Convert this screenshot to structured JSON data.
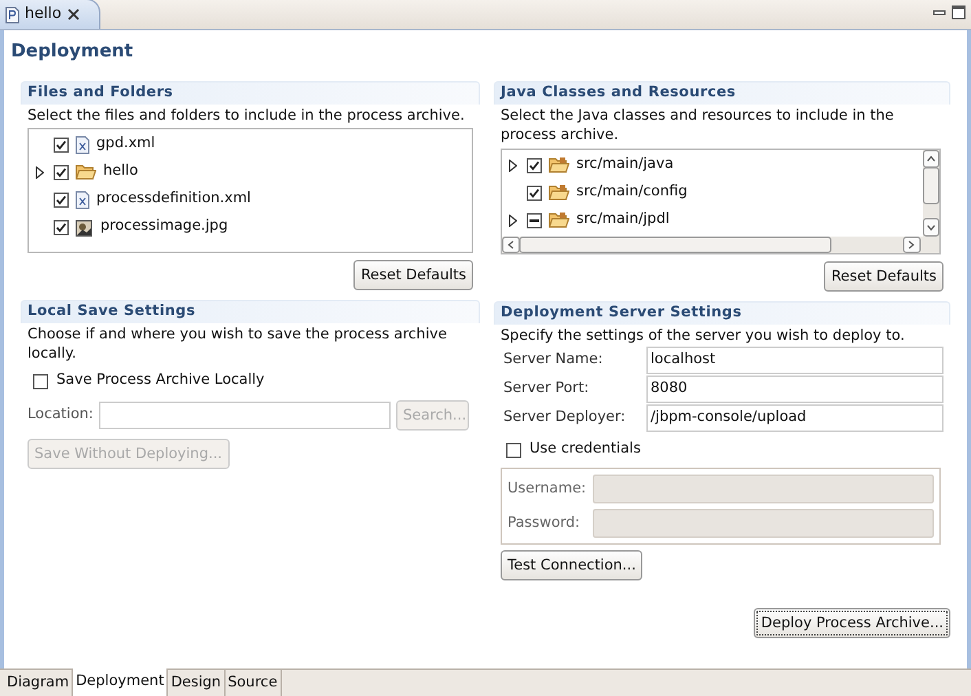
{
  "editor_tab": {
    "label": "hello",
    "selected": true
  },
  "page_title": "Deployment",
  "files": {
    "title": "Files and Folders",
    "description": "Select the files and folders to include in the process archive.",
    "items": [
      {
        "name": "gpd.xml",
        "kind": "xml",
        "checked": true,
        "partial": false,
        "expandable": false
      },
      {
        "name": "hello",
        "kind": "folder",
        "checked": true,
        "partial": false,
        "expandable": true
      },
      {
        "name": "processdefinition.xml",
        "kind": "xml",
        "checked": true,
        "partial": false,
        "expandable": false
      },
      {
        "name": "processimage.jpg",
        "kind": "image",
        "checked": true,
        "partial": false,
        "expandable": false
      }
    ],
    "reset_button": "Reset Defaults"
  },
  "classes": {
    "title": "Java Classes and Resources",
    "description": "Select the Java classes and resources to include in the process archive.",
    "items": [
      {
        "name": "src/main/java",
        "kind": "package",
        "checked": true,
        "partial": false,
        "expandable": true
      },
      {
        "name": "src/main/config",
        "kind": "package",
        "checked": true,
        "partial": false,
        "expandable": false
      },
      {
        "name": "src/main/jpdl",
        "kind": "package",
        "checked": true,
        "partial": true,
        "expandable": true
      }
    ],
    "reset_button": "Reset Defaults"
  },
  "local_save": {
    "title": "Local Save Settings",
    "description": "Choose if and where you wish to save the process archive locally.",
    "save_locally": {
      "label": "Save Process Archive Locally",
      "checked": false
    },
    "location_label": "Location:",
    "search_button": {
      "label": "Search...",
      "disabled": true
    },
    "save_button": {
      "label": "Save Without Deploying...",
      "disabled": true
    }
  },
  "server": {
    "title": "Deployment Server Settings",
    "description": "Specify the settings of the server you wish to deploy to.",
    "fields": [
      {
        "label": "Server Name:",
        "value": "localhost"
      },
      {
        "label": "Server Port:",
        "value": "8080"
      },
      {
        "label": "Server Deployer:",
        "value": "/jbpm-console/upload"
      }
    ],
    "use_credentials": {
      "label": "Use credentials",
      "checked": false
    },
    "credentials": [
      {
        "label": "Username:",
        "disabled": true
      },
      {
        "label": "Password:",
        "disabled": true
      }
    ],
    "test_button": "Test Connection..."
  },
  "deploy_button": {
    "label": "Deploy Process Archive...",
    "focused": true
  },
  "page_tabs": [
    {
      "label": "Diagram",
      "selected": false
    },
    {
      "label": "Deployment",
      "selected": true
    },
    {
      "label": "Design",
      "selected": false
    },
    {
      "label": "Source",
      "selected": false
    }
  ]
}
